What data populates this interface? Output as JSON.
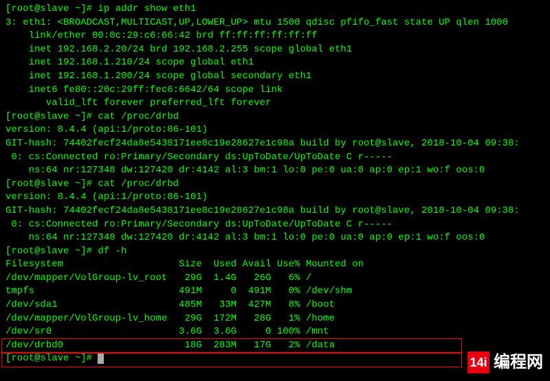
{
  "prompt1": "[root@slave ~]# ",
  "cmd1": "ip addr show eth1",
  "ip_out": {
    "l1": "3: eth1: <BROADCAST,MULTICAST,UP,LOWER_UP> mtu 1500 qdisc pfifo_fast state UP qlen 1000",
    "l2": "    link/ether 00:0c:29:c6:66:42 brd ff:ff:ff:ff:ff:ff",
    "l3": "    inet 192.168.2.20/24 brd 192.168.2.255 scope global eth1",
    "l4": "    inet 192.168.1.210/24 scope global eth1",
    "l5": "    inet 192.168.1.200/24 scope global secondary eth1",
    "l6": "    inet6 fe80::20c:29ff:fec6:6642/64 scope link ",
    "l7": "       valid_lft forever preferred_lft forever"
  },
  "prompt2": "[root@slave ~]# ",
  "cmd2": "cat /proc/drbd",
  "drbd1": {
    "l1": "version: 8.4.4 (api:1/proto:86-101)",
    "l2": "GIT-hash: 74402fecf24da8e5438171ee8c19e28627e1c98a build by root@slave, 2018-10-04 09:38:",
    "l3": " 0: cs:Connected ro:Primary/Secondary ds:UpToDate/UpToDate C r-----",
    "l4": "    ns:64 nr:127348 dw:127420 dr:4142 al:3 bm:1 lo:0 pe:0 ua:0 ap:0 ep:1 wo:f oos:0"
  },
  "prompt3": "[root@slave ~]# ",
  "cmd3": "cat /proc/drbd",
  "drbd2": {
    "l1": "version: 8.4.4 (api:1/proto:86-101)",
    "l2": "GIT-hash: 74402fecf24da8e5438171ee8c19e28627e1c98a build by root@slave, 2018-10-04 09:38:",
    "l3": " 0: cs:Connected ro:Primary/Secondary ds:UpToDate/UpToDate C r-----",
    "l4": "    ns:64 nr:127348 dw:127420 dr:4142 al:3 bm:1 lo:0 pe:0 ua:0 ap:0 ep:1 wo:f oos:0"
  },
  "prompt4": "[root@slave ~]# ",
  "cmd4": "df -h",
  "df": {
    "header": "Filesystem                    Size  Used Avail Use% Mounted on",
    "r1": "/dev/mapper/VolGroup-lv_root   29G  1.4G   26G   6% /",
    "r2": "tmpfs                         491M     0  491M   0% /dev/shm",
    "r3": "/dev/sda1                     485M   33M  427M   8% /boot",
    "r4": "/dev/mapper/VolGroup-lv_home   29G  172M   28G   1% /home",
    "r5": "/dev/sr0                      3.6G  3.6G     0 100% /mnt",
    "r6": "/dev/drbd0                     18G  283M   17G   2% /data"
  },
  "prompt5": "[root@slave ~]# ",
  "watermark": {
    "icon_text": "14i",
    "text": "编程网"
  }
}
